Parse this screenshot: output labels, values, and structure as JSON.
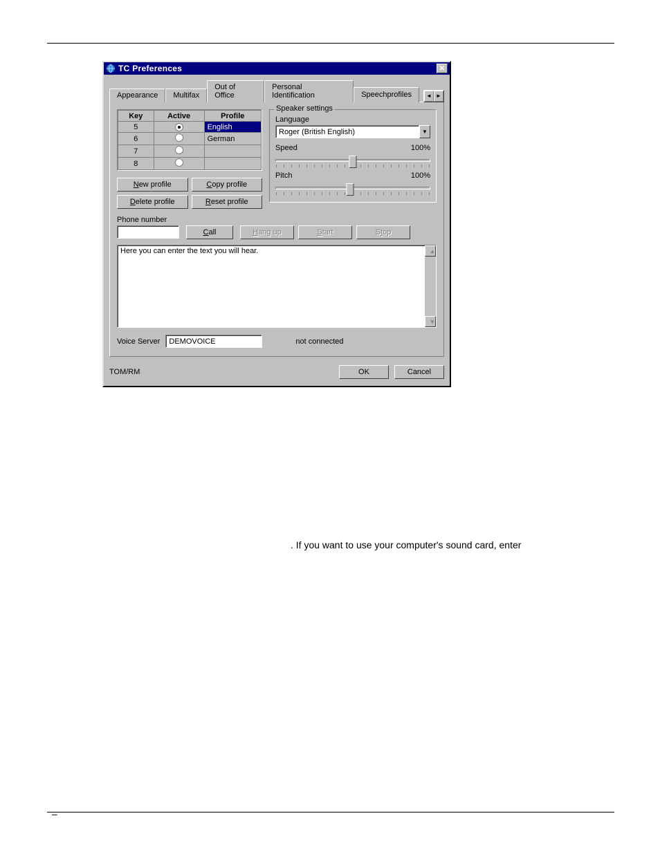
{
  "dialog": {
    "title": "TC Preferences",
    "tabs": [
      "Appearance",
      "Multifax",
      "Out of Office",
      "Personal Identification",
      "Speechprofiles"
    ],
    "activeTab": 4,
    "footerLeft": "TOM/RM",
    "okLabel": "OK",
    "cancelLabel": "Cancel"
  },
  "profileTable": {
    "headers": [
      "Key",
      "Active",
      "Profile"
    ],
    "rows": [
      {
        "key": "5",
        "active": true,
        "profile": "English",
        "selected": true
      },
      {
        "key": "6",
        "active": false,
        "profile": "German",
        "selected": false
      },
      {
        "key": "7",
        "active": false,
        "profile": "",
        "selected": false
      },
      {
        "key": "8",
        "active": false,
        "profile": "",
        "selected": false
      }
    ]
  },
  "profileButtons": {
    "new": "New profile",
    "copy": "Copy profile",
    "delete": "Delete profile",
    "reset": "Reset profile"
  },
  "speaker": {
    "groupTitle": "Speaker settings",
    "languageLabel": "Language",
    "languageValue": "Roger (British English)",
    "speedLabel": "Speed",
    "speedPct": "100%",
    "speedValue": 50,
    "pitchLabel": "Pitch",
    "pitchPct": "100%",
    "pitchValue": 50
  },
  "phone": {
    "label": "Phone number",
    "value": "",
    "callLabel": "Call",
    "hangupLabel": "Hang up",
    "startLabel": "Start",
    "stopLabel": "Stop"
  },
  "speechText": {
    "value": "Here you can enter the text you will hear."
  },
  "voiceServer": {
    "label": "Voice Server",
    "value": "DEMOVOICE",
    "status": "not connected"
  },
  "bodyFragment": ". If you want to use your computer's sound card, enter"
}
